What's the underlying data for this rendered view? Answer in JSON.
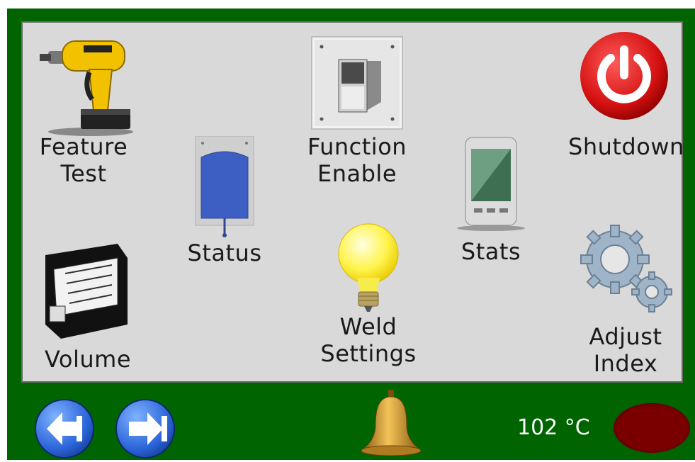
{
  "tiles": {
    "feature_test": {
      "label": "Feature\nTest",
      "icon": "drill-icon"
    },
    "function_enable": {
      "label": "Function\nEnable",
      "icon": "switch-icon"
    },
    "shutdown": {
      "label": "Shutdown",
      "icon": "power-icon"
    },
    "status": {
      "label": "Status",
      "icon": "bag-icon"
    },
    "stats": {
      "label": "Stats",
      "icon": "pda-icon"
    },
    "volume": {
      "label": "Volume",
      "icon": "pump-icon"
    },
    "weld_settings": {
      "label": "Weld\nSettings",
      "icon": "lightbulb-icon"
    },
    "adjust_index": {
      "label": "Adjust\nIndex",
      "icon": "gears-icon"
    }
  },
  "statusbar": {
    "temperature": "102 °C",
    "back_icon": "arrow-left-icon",
    "forward_icon": "arrow-right-icon",
    "alarm_icon": "bell-icon",
    "indicator_color": "#7a0000",
    "background_color": "#006400"
  }
}
